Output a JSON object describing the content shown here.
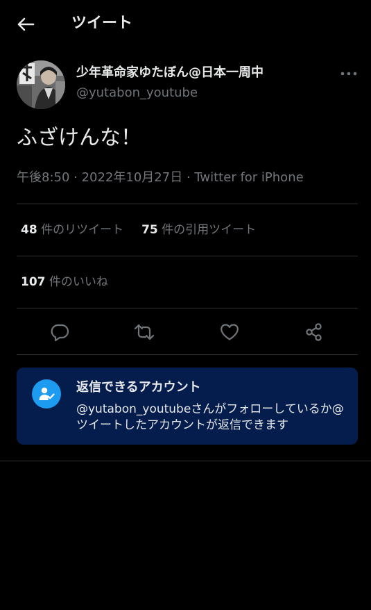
{
  "header": {
    "title": "ツイート",
    "back_icon": "arrow-left-icon"
  },
  "author": {
    "display_name": "少年革命家ゆたぼん@日本一周中",
    "handle": "@yutabon_youtube",
    "more_icon": "more-dots-icon"
  },
  "tweet": {
    "text": "ふざけんな！",
    "time": "午後8:50",
    "separator": " · ",
    "date": "2022年10月27日",
    "source": "Twitter for iPhone"
  },
  "stats": {
    "retweets_count": "48",
    "retweets_label": " 件のリツイート",
    "quotes_count": "75",
    "quotes_label": " 件の引用ツイート",
    "likes_count": "107",
    "likes_label": " 件のいいね"
  },
  "actions": [
    {
      "name": "reply",
      "icon": "reply-icon"
    },
    {
      "name": "retweet",
      "icon": "retweet-icon"
    },
    {
      "name": "like",
      "icon": "heart-icon"
    },
    {
      "name": "share",
      "icon": "share-icon"
    }
  ],
  "reply_notice": {
    "title": "返信できるアカウント",
    "body": "@yutabon_youtubeさんがフォローしているか@ツイートしたアカウントが返信できます",
    "icon": "person-check-icon"
  },
  "colors": {
    "background": "#000000",
    "text_primary": "#e7e9ea",
    "text_secondary": "#71767b",
    "divider": "#2f3336",
    "accent": "#1d9bf0",
    "notice_background": "#051d4d"
  }
}
